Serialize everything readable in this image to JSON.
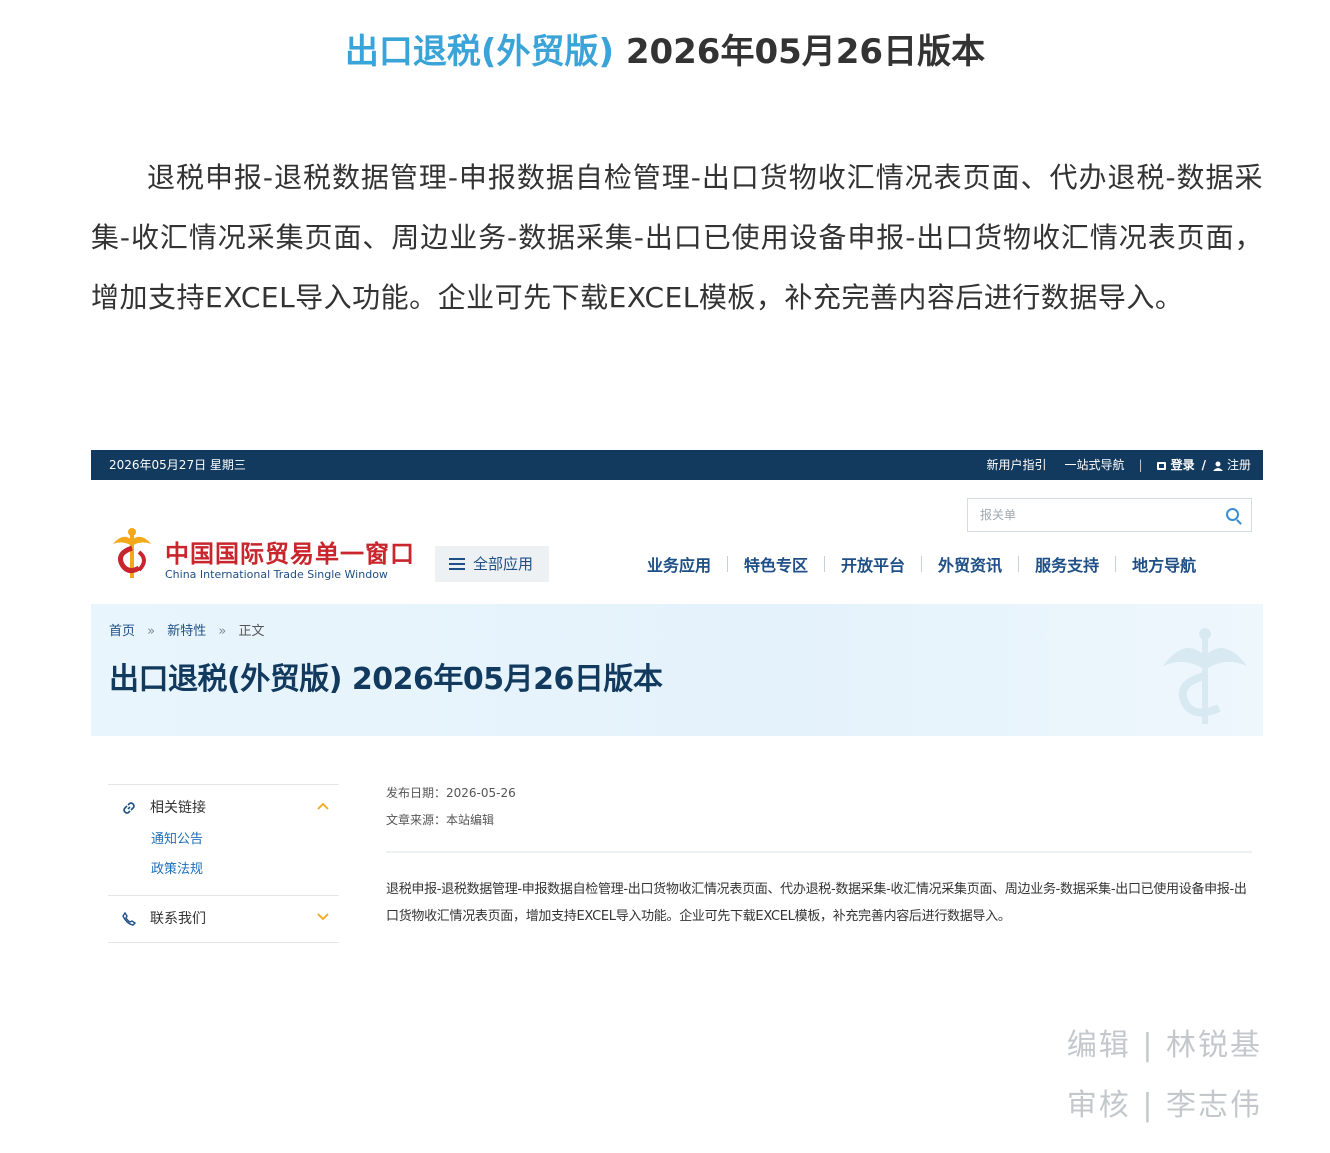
{
  "article": {
    "title_blue": "出口退税(外贸版)",
    "title_dark": "2026年05月26日版本",
    "body": "退税申报-退税数据管理-申报数据自检管理-出口货物收汇情况表页面、代办退税-数据采集-收汇情况采集页面、周边业务-数据采集-出口已使用设备申报-出口货物收汇情况表页面，增加支持EXCEL导入功能。企业可先下载EXCEL模板，补充完善内容后进行数据导入。"
  },
  "screenshot": {
    "topbar": {
      "date": "2026年05月27日 星期三",
      "guide": "新用户指引",
      "onestop": "一站式导航",
      "login": "登录",
      "register": "注册"
    },
    "logo": {
      "cn": "中国国际贸易单一窗口",
      "en": "China International Trade Single Window"
    },
    "all_apps": "全部应用",
    "search_placeholder": "报关单",
    "nav": [
      "业务应用",
      "特色专区",
      "开放平台",
      "外贸资讯",
      "服务支持",
      "地方导航"
    ],
    "breadcrumb": {
      "home": "首页",
      "section": "新特性",
      "current": "正文"
    },
    "page_title": "出口退税(外贸版) 2026年05月26日版本",
    "sidebar": {
      "related": "相关链接",
      "links": [
        "通知公告",
        "政策法规"
      ],
      "contact": "联系我们"
    },
    "meta": {
      "date": "发布日期：2026-05-26",
      "source": "文章来源：本站编辑"
    },
    "content": "退税申报-退税数据管理-申报数据自检管理-出口货物收汇情况表页面、代办退税-数据采集-收汇情况采集页面、周边业务-数据采集-出口已使用设备申报-出口货物收汇情况表页面，增加支持EXCEL导入功能。企业可先下载EXCEL模板，补充完善内容后进行数据导入。"
  },
  "credits": {
    "editor": "编辑 | 林锐基",
    "reviewer": "审核 | 李志伟"
  },
  "colors": {
    "title_blue": "#3aa3d8",
    "topbar_bg": "#12395e",
    "nav_blue": "#1e4f86",
    "logo_red": "#c8252c",
    "credits_gray": "#c4c8cd"
  }
}
